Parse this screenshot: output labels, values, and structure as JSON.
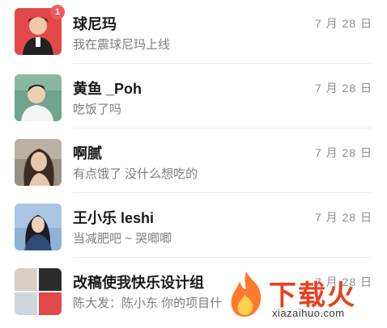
{
  "conversations": [
    {
      "name": "球尼玛",
      "last_message": "我在震球尼玛上线",
      "date": "7 月 28 日",
      "unread": "1"
    },
    {
      "name": "黄鱼 _Poh",
      "last_message": "吃饭了吗",
      "date": "7 月 28 日"
    },
    {
      "name": "啊腻",
      "last_message": "有点饿了 没什么想吃的",
      "date": "7 月 28 日"
    },
    {
      "name": "王小乐 leshi",
      "last_message": "当减肥吧 ~ 哭唧唧",
      "date": "7 月 28 日"
    },
    {
      "name": "改稿使我快乐设计组",
      "last_message": "陈大发：陈小东 你的项目什",
      "date": "7 月 28 日"
    }
  ],
  "watermark": {
    "text": "下载火",
    "url": "xiazaihuo.com"
  }
}
